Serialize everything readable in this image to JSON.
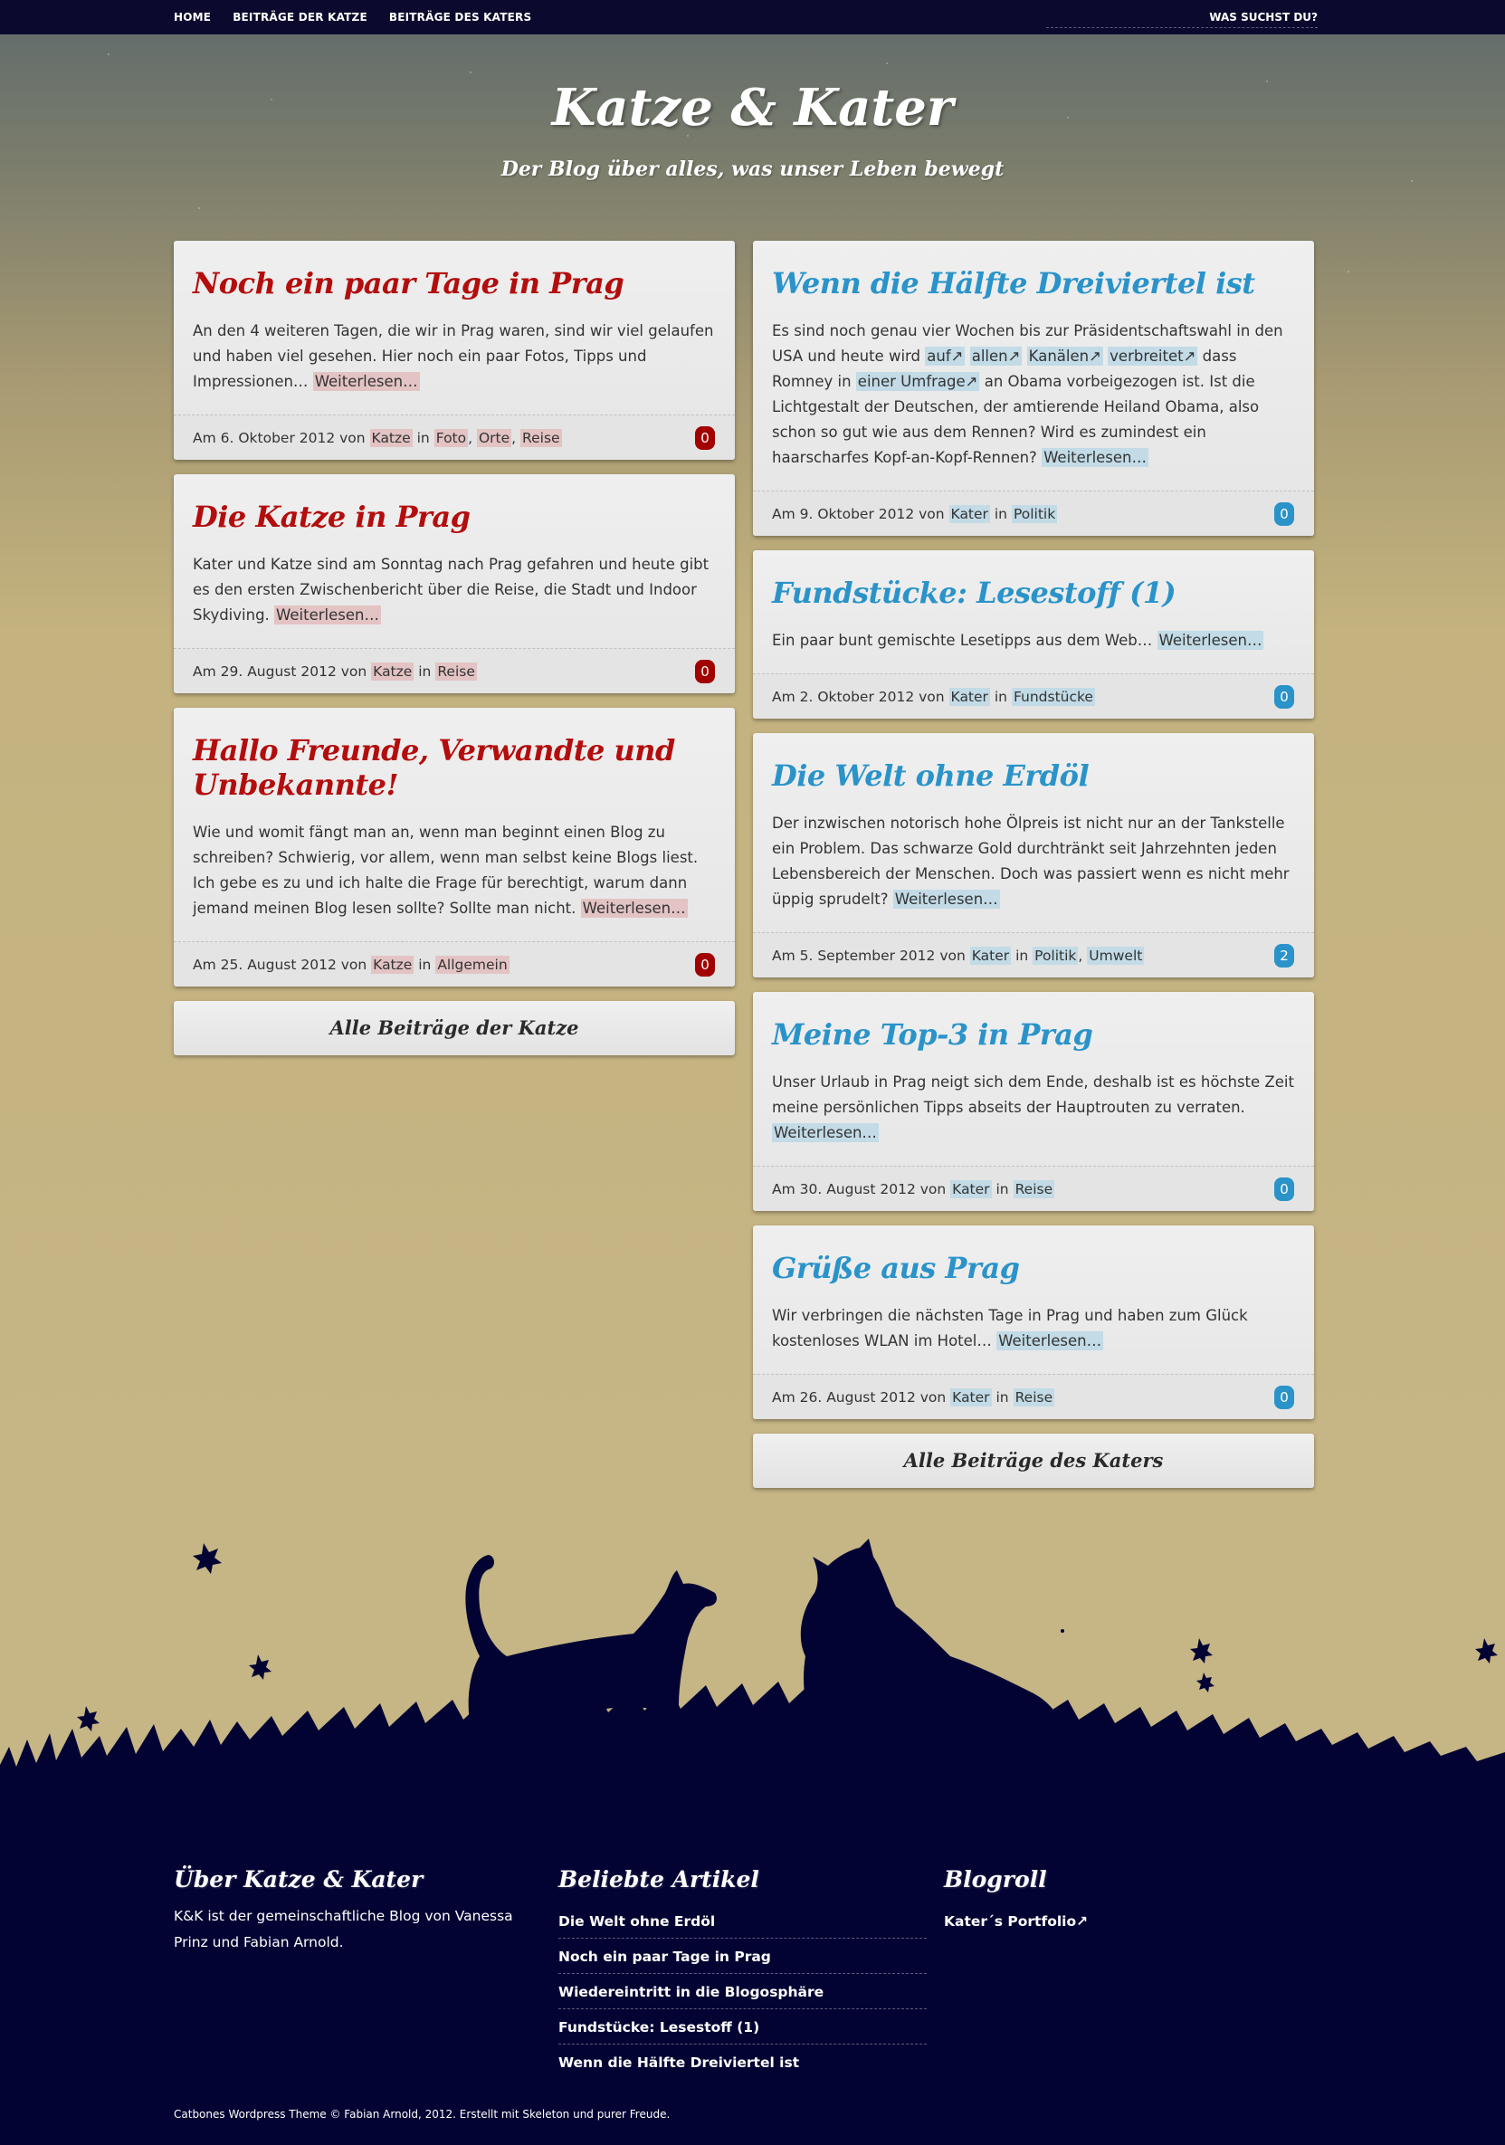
{
  "nav": {
    "items": [
      "HOME",
      "BEITRÄGE DER KATZE",
      "BEITRÄGE DES KATERS"
    ],
    "search_placeholder": "WAS SUCHST DU?"
  },
  "header": {
    "title": "Katze & Kater",
    "subtitle": "Der Blog über alles, was unser Leben bewegt"
  },
  "left": {
    "posts": [
      {
        "title": "Noch ein paar Tage in Prag",
        "excerpt": "An den 4 weiteren Tagen, die wir in Prag waren, sind wir viel gelaufen und haben viel gesehen. Hier noch ein paar Fotos, Tipps und Impressionen…",
        "more": "Weiterlesen…",
        "date": "Am 6. Oktober 2012 von",
        "author": "Katze",
        "in": "in",
        "categories": [
          "Foto",
          "Orte",
          "Reise"
        ],
        "comments": "0"
      },
      {
        "title": "Die Katze in Prag",
        "excerpt": "Kater und Katze sind am Sonntag nach Prag gefahren und heute gibt es den ersten Zwischenbericht über die Reise, die Stadt und Indoor Skydiving.",
        "more": "Weiterlesen…",
        "date": "Am 29. August 2012 von",
        "author": "Katze",
        "in": "in",
        "categories": [
          "Reise"
        ],
        "comments": "0"
      },
      {
        "title": "Hallo Freunde, Verwandte und Unbekannte!",
        "excerpt": "Wie und womit fängt man an, wenn man beginnt einen Blog zu schreiben? Schwierig, vor allem, wenn man selbst keine Blogs liest. Ich gebe es zu und ich halte die Frage für berechtigt, warum dann jemand meinen Blog lesen sollte? Sollte man nicht.",
        "more": "Weiterlesen…",
        "date": "Am 25. August 2012 von",
        "author": "Katze",
        "in": "in",
        "categories": [
          "Allgemein"
        ],
        "comments": "0"
      }
    ],
    "all_button": "Alle Beiträge der Katze"
  },
  "right": {
    "posts": [
      {
        "title": "Wenn die Hälfte Dreiviertel ist",
        "excerpt_parts": [
          "Es sind noch genau vier Wochen bis zur Präsidentschaftswahl in den USA und heute wird ",
          "auf↗",
          " ",
          "allen↗",
          " ",
          "Kanälen↗",
          " ",
          "verbreitet↗",
          " dass Romney in ",
          "einer Umfrage↗",
          " an Obama vorbeigezogen ist. Ist die Lichtgestalt der Deutschen, der amtierende Heiland Obama, also schon so gut wie aus dem Rennen? Wird es zumindest ein haarscharfes Kopf-an-Kopf-Rennen?  "
        ],
        "more": "Weiterlesen…",
        "date": "Am 9. Oktober 2012 von",
        "author": "Kater",
        "in": "in",
        "categories": [
          "Politik"
        ],
        "comments": "0"
      },
      {
        "title": "Fundstücke: Lesestoff (1)",
        "excerpt": "Ein paar bunt gemischte Lesetipps aus dem Web…",
        "more": "Weiterlesen…",
        "date": "Am 2. Oktober 2012 von",
        "author": "Kater",
        "in": "in",
        "categories": [
          "Fundstücke"
        ],
        "comments": "0"
      },
      {
        "title": "Die Welt ohne Erdöl",
        "excerpt": "Der inzwischen notorisch hohe Ölpreis ist nicht nur an der Tankstelle ein Problem. Das schwarze Gold durchtränkt seit Jahrzehnten jeden Lebensbereich der Menschen. Doch was passiert wenn es nicht mehr üppig sprudelt?",
        "more": "Weiterlesen…",
        "date": "Am 5. September 2012 von",
        "author": "Kater",
        "in": "in",
        "categories": [
          "Politik",
          "Umwelt"
        ],
        "comments": "2"
      },
      {
        "title": "Meine Top-3 in Prag",
        "excerpt": "Unser Urlaub in Prag neigt sich dem Ende, deshalb ist es höchste Zeit meine persönlichen Tipps abseits der Hauptrouten zu verraten.",
        "more": "Weiterlesen…",
        "date": "Am 30. August 2012 von",
        "author": "Kater",
        "in": "in",
        "categories": [
          "Reise"
        ],
        "comments": "0"
      },
      {
        "title": "Grüße aus Prag",
        "excerpt": "Wir verbringen die nächsten Tage in Prag und haben zum Glück kostenloses WLAN im Hotel…",
        "more": "Weiterlesen…",
        "date": "Am 26. August 2012 von",
        "author": "Kater",
        "in": "in",
        "categories": [
          "Reise"
        ],
        "comments": "0"
      }
    ],
    "all_button": "Alle Beiträge des Katers"
  },
  "footer": {
    "about": {
      "title": "Über Katze & Kater",
      "text": "K&K ist der gemeinschaftliche Blog von Vanessa Prinz und Fabian Arnold."
    },
    "popular": {
      "title": "Beliebte Artikel",
      "items": [
        "Die Welt ohne Erdöl",
        "Noch ein paar Tage in Prag",
        "Wiedereintritt in die Blogosphäre",
        "Fundstücke: Lesestoff (1)",
        "Wenn die Hälfte Dreiviertel ist"
      ]
    },
    "blogroll": {
      "title": "Blogroll",
      "items": [
        "Kater´s Portfolio↗"
      ]
    },
    "copyright": "Catbones Wordpress Theme © Fabian Arnold, 2012. Erstellt mit Skeleton und purer Freude."
  },
  "colors": {
    "katze_accent": "#b30d0d",
    "kater_accent": "#2a93c9",
    "nav_bg": "#0b0a2e",
    "footer_bg": "#030333"
  }
}
